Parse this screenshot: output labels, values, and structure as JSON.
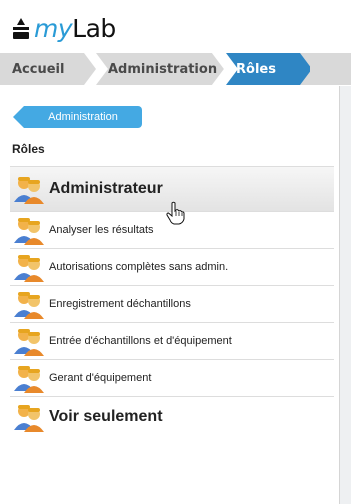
{
  "app": {
    "logo_prefix": "my",
    "logo_suffix": "Lab"
  },
  "breadcrumb": [
    {
      "label": "Accueil"
    },
    {
      "label": "Administration"
    },
    {
      "label": "Rôles"
    }
  ],
  "back_button": {
    "label": "Administration"
  },
  "section": {
    "title": "Rôles"
  },
  "roles": [
    {
      "label": "Administrateur",
      "icon": "user-group-icon"
    },
    {
      "label": "Analyser les résultats",
      "icon": "user-group-icon"
    },
    {
      "label": "Autorisations complètes sans admin.",
      "icon": "user-group-icon"
    },
    {
      "label": "Enregistrement déchantillons",
      "icon": "user-group-icon"
    },
    {
      "label": "Entrée d'échantillons et d'équipement",
      "icon": "user-group-icon"
    },
    {
      "label": "Gerant d'équipement",
      "icon": "user-group-icon"
    },
    {
      "label": "Voir seulement",
      "icon": "user-group-icon"
    }
  ],
  "colors": {
    "accent": "#2f86c4",
    "button": "#44a9e3",
    "breadcrumb_bg": "#d9d9d9"
  }
}
